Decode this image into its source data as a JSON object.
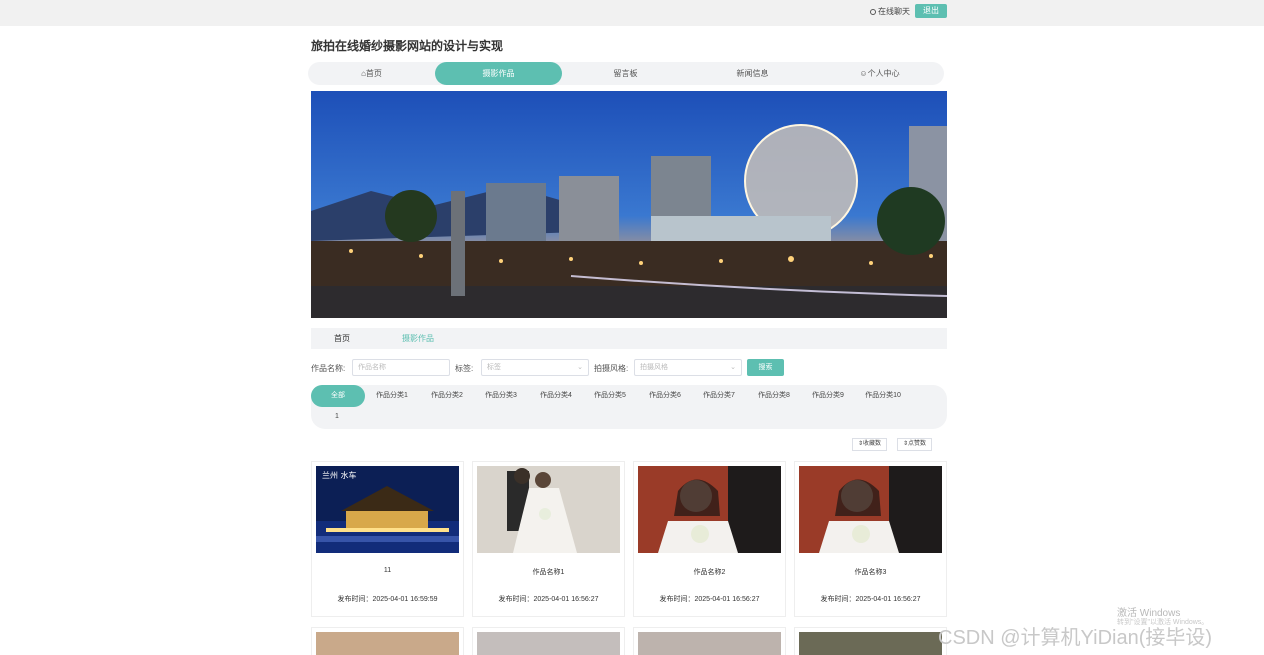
{
  "topbar": {
    "service": "在线聊天",
    "logout": "退出"
  },
  "site_title": "旅拍在线婚纱摄影网站的设计与实现",
  "nav": [
    {
      "label": "首页",
      "icon": "home-icon"
    },
    {
      "label": "摄影作品"
    },
    {
      "label": "留言板"
    },
    {
      "label": "新闻信息"
    },
    {
      "label": "个人中心",
      "icon": "user-icon"
    }
  ],
  "breadcrumb": {
    "home": "首页",
    "current": "摄影作品"
  },
  "filters": {
    "name_label": "作品名称:",
    "name_placeholder": "作品名称",
    "tag_label": "标签:",
    "tag_placeholder": "标签",
    "style_label": "拍摄风格:",
    "style_placeholder": "拍摄风格",
    "search": "搜索"
  },
  "categories": [
    "全部",
    "作品分类1",
    "作品分类2",
    "作品分类3",
    "作品分类4",
    "作品分类5",
    "作品分类6",
    "作品分类7",
    "作品分类8",
    "作品分类9",
    "作品分类10"
  ],
  "categories_more": "1",
  "sort": {
    "favorites": "收藏数",
    "likes": "点赞数"
  },
  "works": [
    {
      "name": "11",
      "time": "发布时间：2025-04-01 16:59:59"
    },
    {
      "name": "作品名称1",
      "time": "发布时间：2025-04-01 16:56:27"
    },
    {
      "name": "作品名称2",
      "time": "发布时间：2025-04-01 16:56:27"
    },
    {
      "name": "作品名称3",
      "time": "发布时间：2025-04-01 16:56:27"
    }
  ],
  "watermarks": {
    "win1": "激活 Windows",
    "win2": "转到\"设置\"以激活 Windows。",
    "csdn": "CSDN @计算机YiDian(接毕设)"
  },
  "colors": {
    "accent": "#5dbfb1",
    "nav_bg": "#f2f3f5",
    "topbar_bg": "#f1f1f1"
  }
}
